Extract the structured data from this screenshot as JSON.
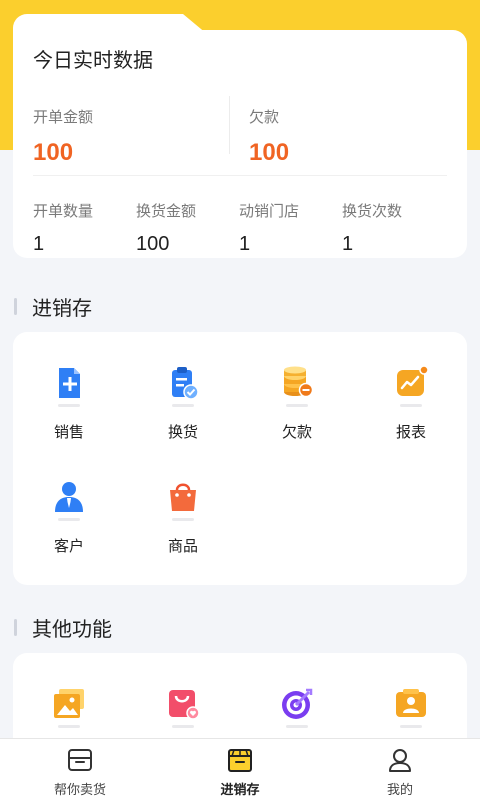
{
  "today": {
    "title": "今日实时数据",
    "order_amount_label": "开单金额",
    "order_amount_value": "100",
    "debt_label": "欠款",
    "debt_value": "100",
    "stats": [
      {
        "label": "开单数量",
        "value": "1"
      },
      {
        "label": "换货金额",
        "value": "100"
      },
      {
        "label": "动销门店",
        "value": "1"
      },
      {
        "label": "换货次数",
        "value": "1"
      }
    ]
  },
  "inventory": {
    "title": "进销存",
    "items": [
      {
        "label": "销售",
        "icon": "sales-doc-icon"
      },
      {
        "label": "换货",
        "icon": "exchange-clipboard-icon"
      },
      {
        "label": "欠款",
        "icon": "debt-coins-icon"
      },
      {
        "label": "报表",
        "icon": "report-chart-icon"
      },
      {
        "label": "客户",
        "icon": "customer-person-icon"
      },
      {
        "label": "商品",
        "icon": "product-bag-icon"
      }
    ]
  },
  "other": {
    "title": "其他功能",
    "items": [
      {
        "icon": "gallery-icon"
      },
      {
        "icon": "shop-bag-heart-icon"
      },
      {
        "icon": "target-icon"
      },
      {
        "icon": "contact-card-icon"
      }
    ]
  },
  "nav": {
    "items": [
      {
        "label": "帮你卖货",
        "icon": "store-icon"
      },
      {
        "label": "进销存",
        "icon": "inventory-icon"
      },
      {
        "label": "我的",
        "icon": "profile-icon"
      }
    ],
    "active_index": 1
  },
  "colors": {
    "accent_yellow": "#fbcf2d",
    "value_orange": "#f06423",
    "blue": "#2f7ff5",
    "orange": "#f5a623"
  }
}
